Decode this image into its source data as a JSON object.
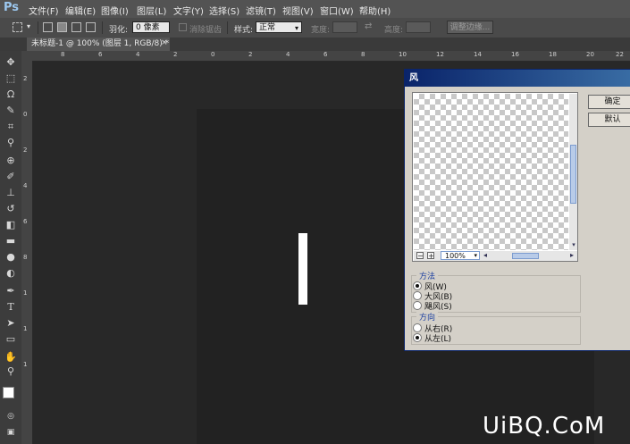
{
  "app": {
    "logo": "Ps"
  },
  "menu": [
    "文件(F)",
    "编辑(E)",
    "图像(I)",
    "图层(L)",
    "文字(Y)",
    "选择(S)",
    "滤镜(T)",
    "视图(V)",
    "窗口(W)",
    "帮助(H)"
  ],
  "options_bar": {
    "feather_label": "羽化:",
    "feather_value": "0 像素",
    "antialias_label": "消除锯齿",
    "style_label": "样式:",
    "style_value": "正常",
    "width_label": "宽度:",
    "height_label": "高度:",
    "refine_edge_button": "调整边缘..."
  },
  "document_tab": {
    "title": "未标题-1 @ 100% (图层 1, RGB/8) *",
    "close": "×"
  },
  "rulers": {
    "top": [
      "8",
      "6",
      "4",
      "2",
      "0",
      "2",
      "4",
      "6",
      "8",
      "10",
      "12",
      "14",
      "16",
      "18",
      "20",
      "22"
    ],
    "left": [
      "2",
      "0",
      "2",
      "4",
      "6",
      "8",
      "1",
      "1",
      "1"
    ]
  },
  "dialog": {
    "title": "风",
    "ok_button": "确定",
    "default_button": "默认",
    "zoom_value": "100%",
    "zoom_minus": "−",
    "zoom_plus": "+",
    "method_legend": "方法",
    "method_options": [
      {
        "label": "风(W)",
        "selected": true
      },
      {
        "label": "大风(B)",
        "selected": false
      },
      {
        "label": "飓风(S)",
        "selected": false
      }
    ],
    "direction_legend": "方向",
    "direction_options": [
      {
        "label": "从右(R)",
        "selected": false
      },
      {
        "label": "从左(L)",
        "selected": true
      }
    ]
  },
  "watermark": "UiBQ.CoM"
}
